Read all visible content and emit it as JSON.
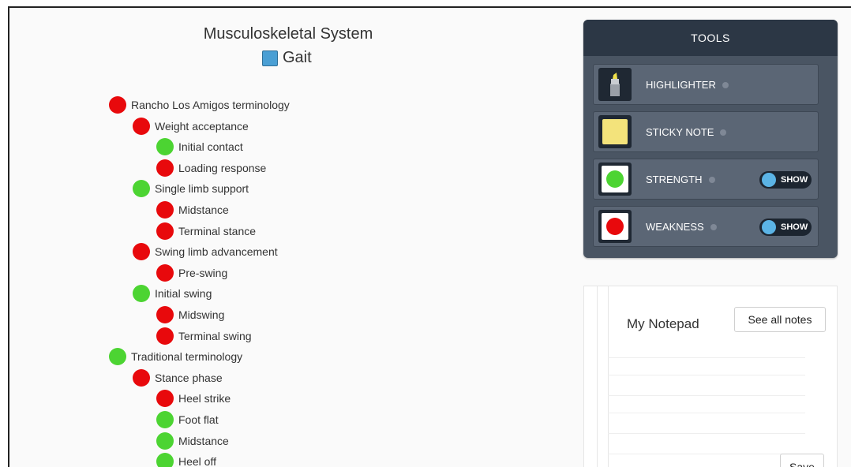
{
  "header": {
    "system_title": "Musculoskeletal System",
    "section_title": "Gait",
    "section_icon": "blue-square-icon"
  },
  "tree": [
    {
      "label": "Rancho Los Amigos terminology",
      "status": "red",
      "level": 0
    },
    {
      "label": "Weight acceptance",
      "status": "red",
      "level": 1
    },
    {
      "label": "Initial contact",
      "status": "green",
      "level": 2
    },
    {
      "label": "Loading response",
      "status": "red",
      "level": 2
    },
    {
      "label": "Single limb support",
      "status": "green",
      "level": 1
    },
    {
      "label": "Midstance",
      "status": "red",
      "level": 2
    },
    {
      "label": "Terminal stance",
      "status": "red",
      "level": 2
    },
    {
      "label": "Swing limb advancement",
      "status": "red",
      "level": 1
    },
    {
      "label": "Pre-swing",
      "status": "red",
      "level": 2
    },
    {
      "label": "Initial swing",
      "status": "green",
      "level": 1
    },
    {
      "label": "Midswing",
      "status": "red",
      "level": 2
    },
    {
      "label": "Terminal swing",
      "status": "red",
      "level": 2
    },
    {
      "label": "Traditional terminology",
      "status": "green",
      "level": 0
    },
    {
      "label": "Stance phase",
      "status": "red",
      "level": 1
    },
    {
      "label": "Heel strike",
      "status": "red",
      "level": 2
    },
    {
      "label": "Foot flat",
      "status": "green",
      "level": 2
    },
    {
      "label": "Midstance",
      "status": "green",
      "level": 2
    },
    {
      "label": "Heel off",
      "status": "green",
      "level": 2
    }
  ],
  "tools": {
    "title": "TOOLS",
    "items": [
      {
        "label": "HIGHLIGHTER",
        "icon": "highlighter-icon"
      },
      {
        "label": "STICKY NOTE",
        "icon": "sticky-note-icon"
      },
      {
        "label": "STRENGTH",
        "icon": "green-dot-icon",
        "toggle": "SHOW"
      },
      {
        "label": "WEAKNESS",
        "icon": "red-dot-icon",
        "toggle": "SHOW"
      }
    ]
  },
  "notepad": {
    "title": "My Notepad",
    "see_all_label": "See all notes",
    "save_label": "Save"
  },
  "colors": {
    "strength": "#4cd432",
    "weakness": "#e8090c",
    "tools_bg": "#4a5563",
    "tools_header": "#2c3745",
    "toggle_knob": "#5bb4e6"
  }
}
